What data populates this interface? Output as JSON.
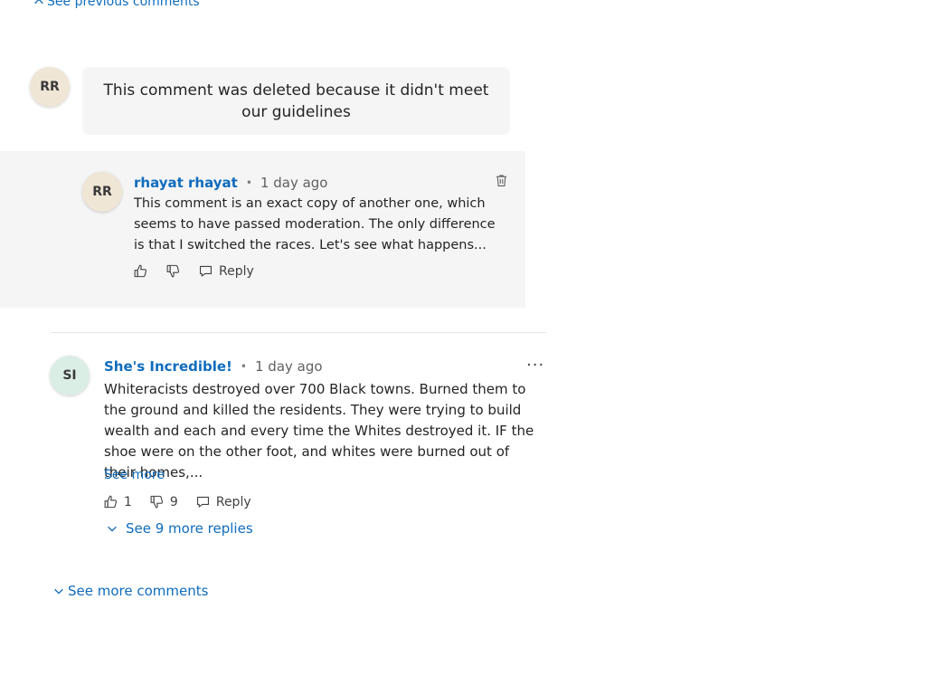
{
  "nav": {
    "see_previous": "See previous comments",
    "see_more_comments": "See more comments"
  },
  "deleted_comment": {
    "avatar_initials": "RR",
    "text": "This comment was deleted because it didn't meet our guidelines"
  },
  "reply": {
    "avatar_initials": "RR",
    "author": "rhayat rhayat",
    "time": "1 day ago",
    "text": "This comment is an exact copy of another one, which seems to have passed moderation. The only difference is that I switched the races. Let's see what happens...",
    "reply_label": "Reply",
    "icons": [
      "thumbs-up-icon",
      "thumbs-down-icon",
      "reply-icon",
      "trash-icon"
    ]
  },
  "comment": {
    "avatar_initials": "SI",
    "author": "She's Incredible!",
    "time": "1 day ago",
    "text": "Whiteracists destroyed over 700 Black towns. Burned them to the ground and killed the residents. They were trying to build wealth and each and every time the Whites destroyed it. IF the shoe were on the other foot, and whites were burned out of their homes,...",
    "see_more": "See more",
    "likes": "1",
    "dislikes": "9",
    "reply_label": "Reply",
    "see_replies": "See 9 more replies",
    "more_menu": "···",
    "icons": [
      "thumbs-up-icon",
      "thumbs-down-icon",
      "reply-icon",
      "more-options-icon",
      "chevron-down-icon"
    ]
  },
  "colors": {
    "link": "#0f6cbd",
    "reply_background": "#f5f5f5",
    "avatar_rr": "#efe6d6",
    "avatar_si": "#dbeee6"
  }
}
